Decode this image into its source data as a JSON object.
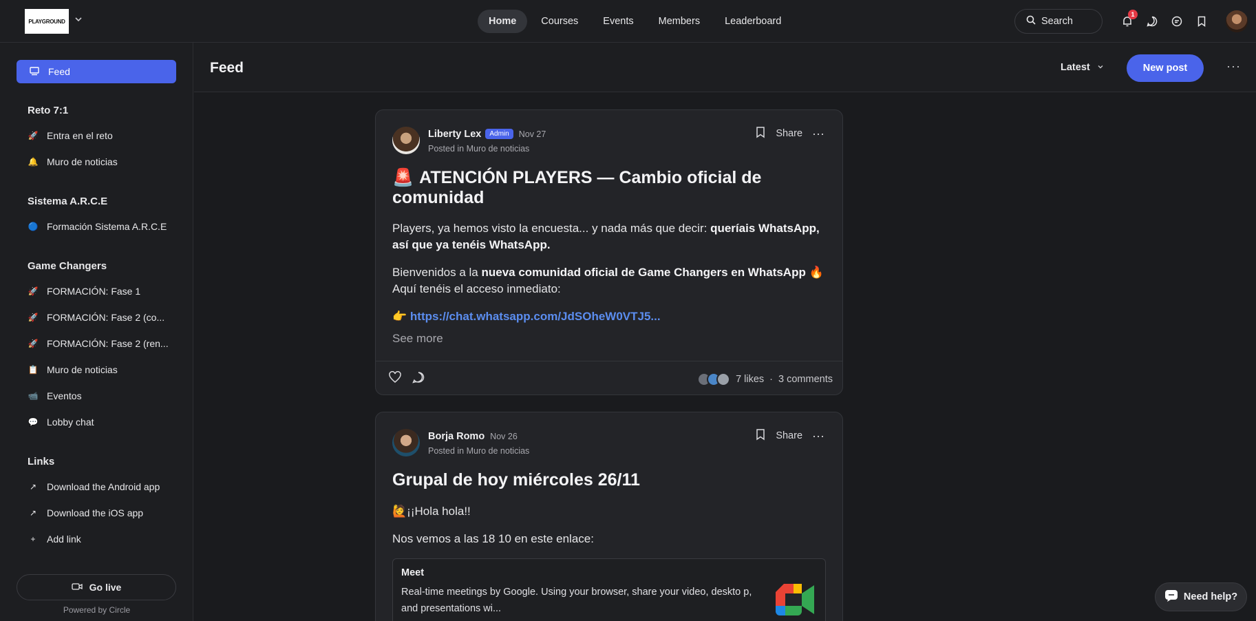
{
  "app": {
    "logo_text": "PLAYGROUND"
  },
  "nav": {
    "items": [
      "Home",
      "Courses",
      "Events",
      "Members",
      "Leaderboard"
    ],
    "active": "Home"
  },
  "search": {
    "label": "Search"
  },
  "notifications": {
    "count": "1"
  },
  "sidebar": {
    "feed_label": "Feed",
    "sections": [
      {
        "title": "Reto 7:1",
        "items": [
          {
            "icon": "rocket-icon",
            "glyph": "🚀",
            "label": "Entra en el reto"
          },
          {
            "icon": "bell-icon",
            "glyph": "🔔",
            "label": "Muro de noticias"
          }
        ]
      },
      {
        "title": "Sistema A.R.C.E",
        "items": [
          {
            "icon": "blue-circle-icon",
            "glyph": "🔵",
            "label": "Formación Sistema A.R.C.E"
          }
        ]
      },
      {
        "title": "Game Changers",
        "items": [
          {
            "icon": "rocket-icon",
            "glyph": "🚀",
            "label": "FORMACIÓN: Fase 1"
          },
          {
            "icon": "rocket-icon",
            "glyph": "🚀",
            "label": "FORMACIÓN: Fase 2 (co..."
          },
          {
            "icon": "rocket-icon",
            "glyph": "🚀",
            "label": "FORMACIÓN: Fase 2 (ren..."
          },
          {
            "icon": "clipboard-icon",
            "glyph": "📋",
            "label": "Muro de noticias"
          },
          {
            "icon": "camera-icon",
            "glyph": "📹",
            "label": "Eventos"
          },
          {
            "icon": "speech-bubble-icon",
            "glyph": "💬",
            "label": "Lobby chat"
          }
        ]
      },
      {
        "title": "Links",
        "items": [
          {
            "icon": "arrow-up-right-icon",
            "glyph": "↗",
            "label": "Download the Android app"
          },
          {
            "icon": "arrow-up-right-icon",
            "glyph": "↗",
            "label": "Download the iOS app"
          },
          {
            "icon": "plus-icon",
            "glyph": "+",
            "label": "Add link"
          }
        ]
      }
    ],
    "go_live": "Go live",
    "powered_by": "Powered by Circle"
  },
  "header": {
    "title": "Feed",
    "sort_label": "Latest",
    "new_post": "New post"
  },
  "posts": [
    {
      "author": "Liberty Lex",
      "badge": "Admin",
      "date": "Nov 27",
      "posted_in": "Posted in Muro de noticias",
      "share": "Share",
      "title_emoji": "🚨",
      "title": "ATENCIÓN PLAYERS — Cambio oficial de comunidad",
      "p1_normal": "Players, ya hemos visto la encuesta... y nada más que decir: ",
      "p1_bold": "queríais WhatsApp, así que ya tenéis WhatsApp.",
      "p2_normal": "Bienvenidos a la ",
      "p2_bold": "nueva comunidad oficial de Game Changers en WhatsApp",
      "p2_emoji": "🔥",
      "p3": "Aquí tenéis el acceso inmediato:",
      "link_emoji": "👉",
      "link": "https://chat.whatsapp.com/JdSOheW0VTJ5...",
      "see_more": "See more",
      "likes": "7 likes",
      "comments": "3 comments"
    },
    {
      "author": "Borja Romo",
      "date": "Nov 26",
      "posted_in": "Posted in Muro de noticias",
      "share": "Share",
      "title": "Grupal de hoy miércoles 26/11",
      "p1_emoji": "🙋",
      "p1": "¡¡Hola hola!!",
      "p2": "Nos vemos a las 18 10 en este enlace:",
      "embed_title": "Meet",
      "embed_desc": "Real-time meetings by Google. Using your browser, share your video, deskto p, and presentations wi..."
    }
  ],
  "help": {
    "label": "Need help?"
  },
  "colors": {
    "accent": "#4a64ea",
    "link": "#5b8def",
    "background": "#1a1b1e",
    "card": "#232428"
  }
}
